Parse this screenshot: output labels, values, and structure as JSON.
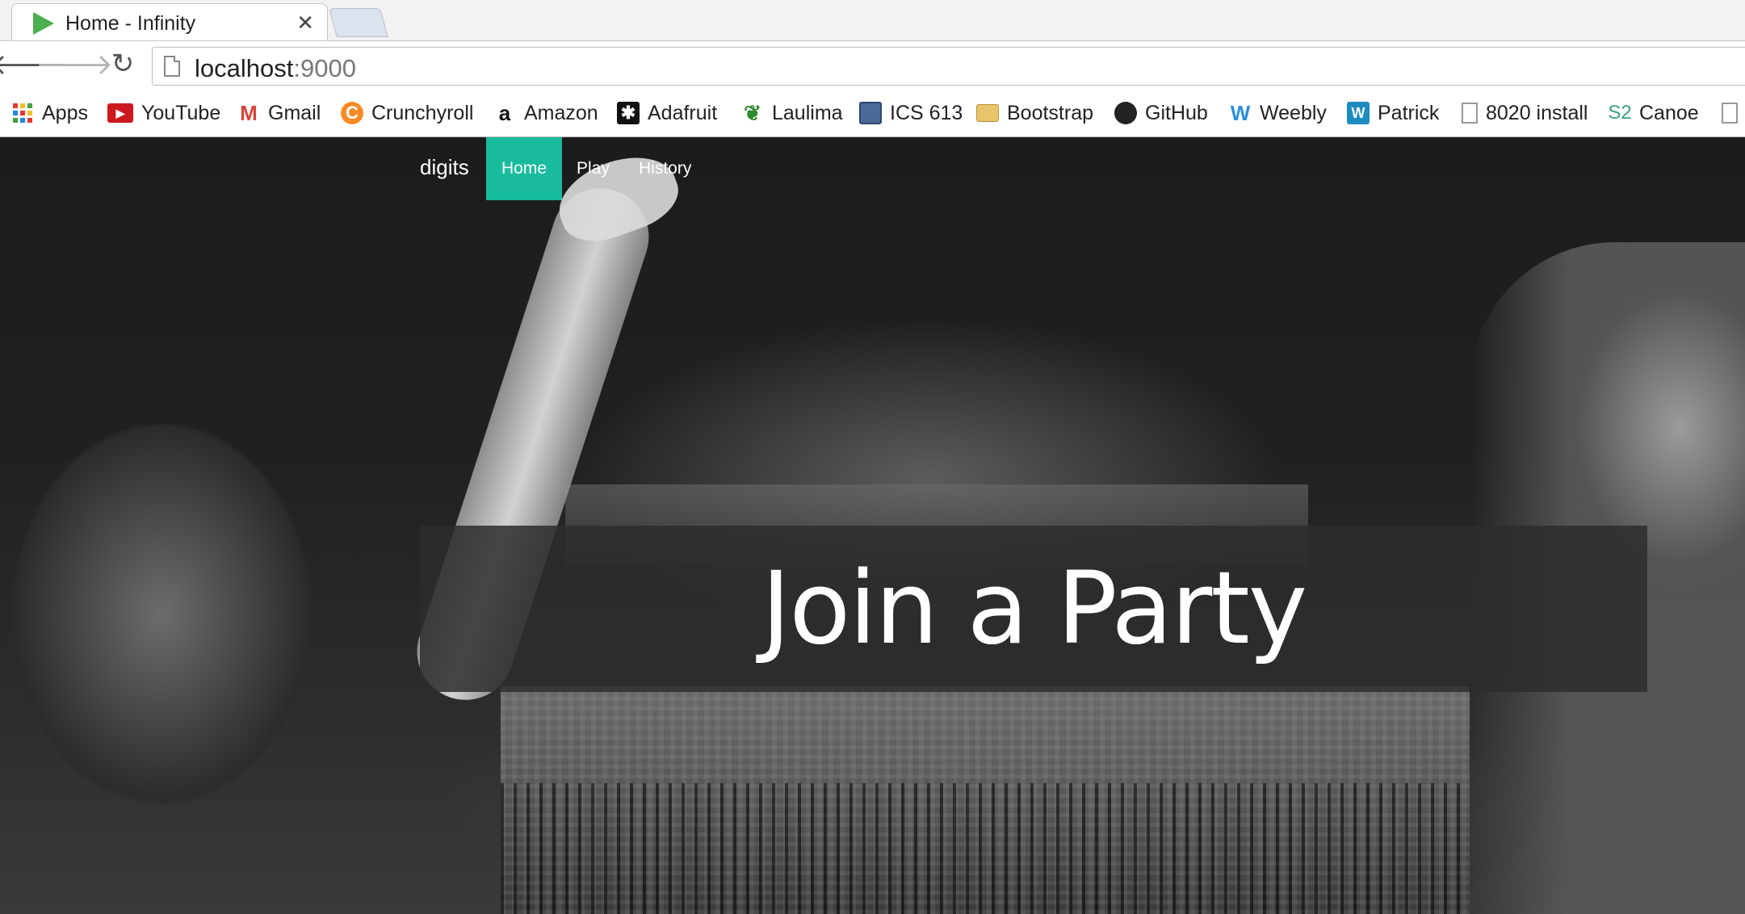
{
  "browser": {
    "tab": {
      "title": "Home - Infinity",
      "close_glyph": "✕"
    },
    "toolbar": {
      "back_glyph": "🡐",
      "forward_glyph": "🡒",
      "reload_glyph": "↻",
      "url_host": "localhost",
      "url_port": ":9000"
    },
    "bookmarks": [
      {
        "label": "Apps",
        "icon": "apps-icon"
      },
      {
        "label": "YouTube",
        "icon": "youtube-icon",
        "glyph": "▶",
        "color": "#cc181e"
      },
      {
        "label": "Gmail",
        "icon": "gmail-icon",
        "glyph": "M",
        "color": "#d44638"
      },
      {
        "label": "Crunchyroll",
        "icon": "crunchyroll-icon",
        "glyph": "C",
        "color": "#f78c25"
      },
      {
        "label": "Amazon",
        "icon": "amazon-icon",
        "glyph": "a",
        "color": "#111111"
      },
      {
        "label": "Adafruit",
        "icon": "adafruit-icon",
        "glyph": "✱",
        "color": "#111111"
      },
      {
        "label": "Laulima",
        "icon": "laulima-icon",
        "glyph": "❦",
        "color": "#2e8b2e"
      },
      {
        "label": "ICS 613",
        "icon": "ics613-icon",
        "glyph": "",
        "color": "#4a6a9a"
      },
      {
        "label": "Bootstrap",
        "icon": "folder-icon",
        "glyph": "",
        "color": "#e8c46a"
      },
      {
        "label": "GitHub",
        "icon": "github-icon",
        "glyph": "●",
        "color": "#222222"
      },
      {
        "label": "Weebly",
        "icon": "weebly-icon",
        "glyph": "W",
        "color": "#2a8fe0"
      },
      {
        "label": "Patrick",
        "icon": "wordpress-icon",
        "glyph": "W",
        "color": "#1e8cbe"
      },
      {
        "label": "8020 install",
        "icon": "page-icon",
        "glyph": "",
        "color": "#ffffff"
      },
      {
        "label": "Canoe",
        "icon": "s2-icon",
        "glyph": "S2",
        "color": "#3aa37a"
      }
    ]
  },
  "site": {
    "brand": "digits",
    "nav": [
      "Home",
      "Play",
      "History"
    ],
    "active_nav": "Home",
    "accent": "#18bc9c",
    "hero_title": "Join a Party"
  }
}
